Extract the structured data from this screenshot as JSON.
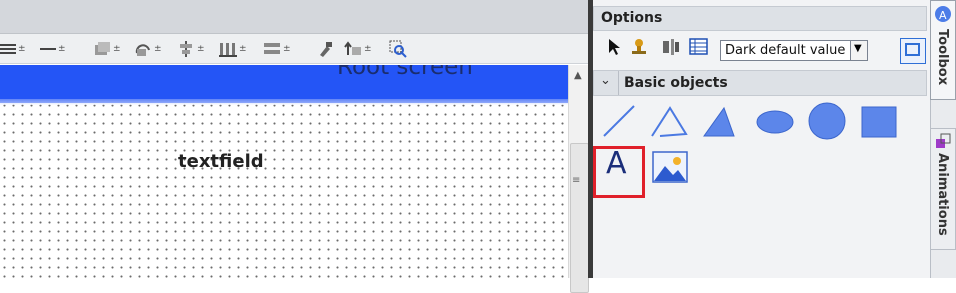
{
  "screen": {
    "title": "Root screen",
    "text_object_label": "textfield"
  },
  "options_panel": {
    "title": "Options",
    "style_dropdown_value": "Dark default value"
  },
  "basic_objects": {
    "title": "Basic objects",
    "items": [
      "line",
      "polyline",
      "polygon",
      "ellipse",
      "circle",
      "rectangle",
      "text field",
      "graphic view"
    ],
    "text_glyph": "A"
  },
  "side_tabs": {
    "toolbox": "Toolbox",
    "animations": "Animations"
  },
  "colors": {
    "header_band": "#2455f6",
    "highlight": "#e0202a",
    "shape_fill": "#5c86ea"
  }
}
